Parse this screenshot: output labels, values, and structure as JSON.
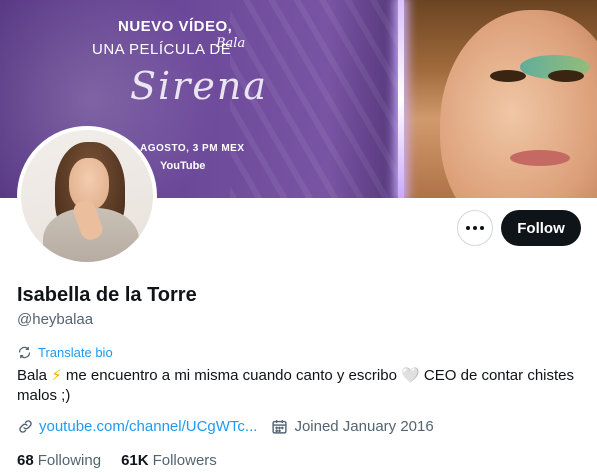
{
  "banner": {
    "line1": "NUEVO VÍDEO,",
    "line2": "UNA PELÍCULA DE",
    "brand": "Bala",
    "title": "Sirena",
    "date": "AGOSTO, 3 PM MEX",
    "platform": "YouTube"
  },
  "profile": {
    "name": "Isabella de la Torre",
    "handle": "@heybalaa",
    "translate_label": "Translate bio",
    "bio_part1": "Bala ",
    "bio_bolt": "⚡",
    "bio_part2": " me encuentro a mi misma cuando canto y escribo ",
    "bio_heart": "🤍",
    "bio_part3": " CEO de contar chistes malos ;)",
    "link_text": "youtube.com/channel/UCgWTc...",
    "joined": "Joined January 2016"
  },
  "actions": {
    "follow_label": "Follow"
  },
  "stats": {
    "following_count": "68",
    "following_label": "Following",
    "followers_count": "61K",
    "followers_label": "Followers"
  },
  "colors": {
    "accent": "#1d9bf0",
    "follow_bg": "#0f1419",
    "secondary_text": "#536471"
  }
}
